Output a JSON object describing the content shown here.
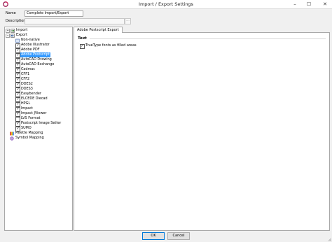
{
  "window": {
    "title": "Import / Export Settings",
    "min": "–",
    "max": "☐",
    "close": "✕"
  },
  "form": {
    "name_label": "Name",
    "name_value": "Complete Import/Export",
    "description_label": "Description",
    "description_value": "",
    "ellipsis": "..."
  },
  "tree": {
    "import": "Import",
    "export": "Export",
    "non_native": "Non-native",
    "items": [
      {
        "label": "Adobe Illustrator",
        "checked": true
      },
      {
        "label": "Adobe PDF",
        "checked": true
      },
      {
        "label": "Adobe Postscript",
        "checked": true,
        "selected": true
      },
      {
        "label": "AutoCAD Drawing",
        "checked": true
      },
      {
        "label": "AutoCAD Exchange",
        "checked": true
      },
      {
        "label": "Cadmac",
        "checked": true
      },
      {
        "label": "CFF1",
        "checked": true
      },
      {
        "label": "CFF2",
        "checked": true
      },
      {
        "label": "DDES2",
        "checked": true
      },
      {
        "label": "DDES3",
        "checked": true
      },
      {
        "label": "Easybender",
        "checked": true
      },
      {
        "label": "ELCEDE Diecad",
        "checked": true
      },
      {
        "label": "HPGL",
        "checked": true
      },
      {
        "label": "Impact",
        "checked": true
      },
      {
        "label": "Impact JViewer",
        "checked": true
      },
      {
        "label": "LVS Format",
        "checked": false
      },
      {
        "label": "Postscript Image Setter",
        "checked": true
      },
      {
        "label": "SUMO",
        "checked": true
      }
    ],
    "palette": "Palette Mapping",
    "symbol": "Symbol Mapping"
  },
  "panel": {
    "tab": "Adobe Postscript Export",
    "group": "Text",
    "option_label": "TrueType fonts as filled areas",
    "option_checked": true
  },
  "buttons": {
    "ok": "OK",
    "cancel": "Cancel"
  },
  "colors": {
    "selection": "#3399ff",
    "ok_border": "#0078d7"
  }
}
